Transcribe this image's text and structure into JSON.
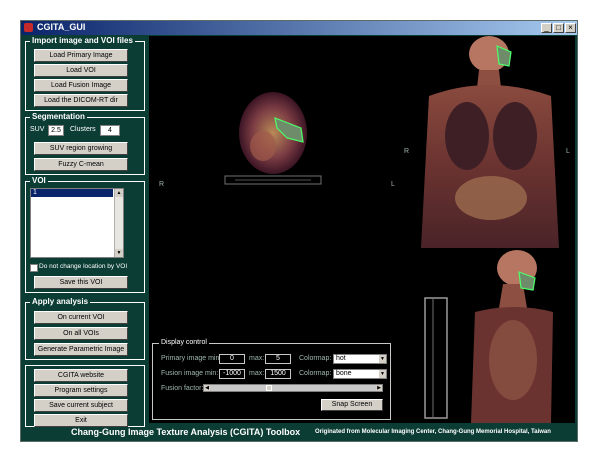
{
  "window": {
    "title": "CGITA_GUI",
    "minimize": "_",
    "maximize": "□",
    "close": "×"
  },
  "import_panel": {
    "title": "Import image and VOI files",
    "buttons": [
      "Load Primary Image",
      "Load VOI",
      "Load Fusion Image",
      "Load the DICOM-RT dir"
    ]
  },
  "segmentation": {
    "title": "Segmentation",
    "suv_label": "SUV",
    "suv_value": "2.5",
    "clusters_label": "Clusters",
    "clusters_value": "4",
    "buttons": [
      "SUV region growing",
      "Fuzzy C-mean"
    ]
  },
  "voi": {
    "title": "VOI",
    "items": [
      "1"
    ],
    "checkbox_label": "Do not change location by VOI",
    "save_button": "Save this VOI"
  },
  "apply": {
    "title": "Apply analysis",
    "buttons": [
      "On current VOI",
      "On all VOIs",
      "Generate Parametric Image"
    ]
  },
  "bottom_buttons": [
    "CGITA website",
    "Program settings",
    "Save current subject",
    "Exit"
  ],
  "views": {
    "axial_right": "R",
    "axial_left": "L",
    "coronal_right": "R",
    "coronal_left": "L"
  },
  "display_control": {
    "title": "Display control",
    "primary_min_label": "Primary image min:",
    "primary_min": "0",
    "primary_max_label": "max:",
    "primary_max": "5",
    "colormap_label": "Colormap:",
    "primary_colormap": "hot",
    "fusion_min_label": "Fusion image min:",
    "fusion_min": "-1000",
    "fusion_max_label": "max:",
    "fusion_max": "1500",
    "fusion_colormap_label": "Colormap:",
    "fusion_colormap": "bone",
    "fusion_factor_label": "Fusion factor:",
    "fusion_factor": 0.35,
    "snap_button": "Snap Screen"
  },
  "footer": {
    "title": "Chang-Gung Image Texture Analysis (CGITA) Toolbox",
    "credit": "Originated from Molecular Imaging Center, Chang-Gung Memorial Hospital, Taiwan"
  },
  "colors": {
    "background": "#0c3d35",
    "titlebar": "#0a246a",
    "button": "#d4d0c8",
    "voi_outline": "#4cff6a"
  },
  "icons": [
    "app-icon",
    "minimize-icon",
    "maximize-icon",
    "close-icon",
    "checkbox-icon",
    "dropdown-arrow-icon"
  ]
}
